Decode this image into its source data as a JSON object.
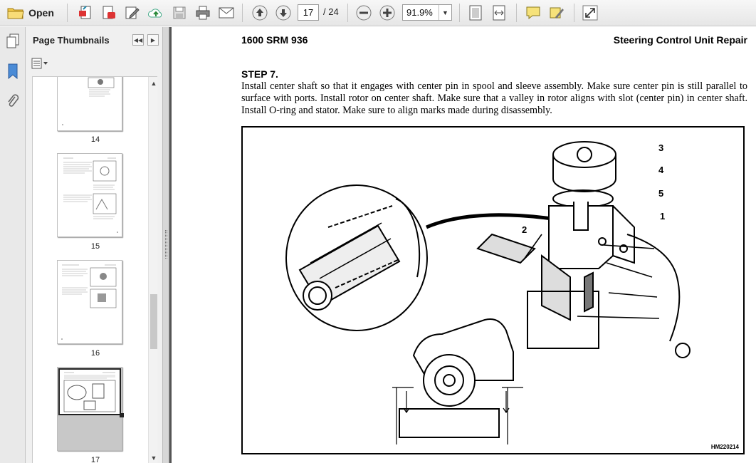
{
  "toolbar": {
    "open_label": "Open",
    "current_page": "17",
    "page_total": "/ 24",
    "zoom": "91.9%"
  },
  "thumbnails_panel": {
    "title": "Page Thumbnails",
    "pages": [
      {
        "number": "14"
      },
      {
        "number": "15"
      },
      {
        "number": "16"
      },
      {
        "number": "17",
        "selected": true
      }
    ]
  },
  "document": {
    "header_left": "1600 SRM 936",
    "header_right": "Steering Control Unit Repair",
    "step_title": "STEP 7.",
    "step_text": "Install center shaft so that it engages with center pin in spool and sleeve assembly. Make sure center pin is still parallel to surface with ports. Install rotor on center shaft. Make sure that a valley in rotor aligns with slot (center pin) in center shaft. Install O-ring and stator. Make sure to align marks made during disassembly.",
    "figure": {
      "callouts": [
        "1",
        "2",
        "3",
        "4",
        "5"
      ],
      "figure_id": "HM220214"
    }
  }
}
